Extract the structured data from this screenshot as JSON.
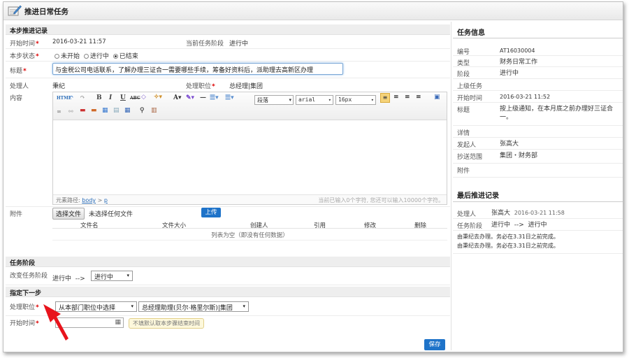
{
  "window": {
    "title": "推进日常任务"
  },
  "left": {
    "section_current": "本步推进记录",
    "start_time": {
      "label": "开始时间",
      "value": "2016-03-21 11:57"
    },
    "current_stage": {
      "label": "当前任务阶段",
      "value": "进行中"
    },
    "step_status": {
      "label": "本步状态",
      "options": [
        "未开始",
        "进行中",
        "已结束"
      ],
      "selected": "已结束"
    },
    "title": {
      "label": "标题",
      "value": "与金税公司电话联系，了解办理三证合一需要哪些手续，筹备好资料后，派助理去高新区办理"
    },
    "handler": {
      "label": "处理人",
      "value": "秉纪"
    },
    "handler_post": {
      "label": "处理职位",
      "value": "总经理|集团"
    },
    "content": {
      "label": "内容",
      "toolbar": {
        "html": "HTML",
        "bold": "B",
        "italic": "I",
        "underline": "U",
        "strike": "ABC",
        "font_color": "A",
        "paragraph": "段落",
        "font_family": "arial",
        "font_size": "16px"
      },
      "path_label": "元素路径:",
      "path_body": "body",
      "path_sep": ">",
      "path_p": "p",
      "counter": "当前已输入0个字符, 您还可以输入10000个字符。"
    },
    "attachment": {
      "label": "附件",
      "choose_btn": "选择文件",
      "no_file": "未选择任何文件",
      "upload_btn": "上传",
      "columns": [
        "文件名",
        "文件大小",
        "创建人",
        "引用",
        "修改",
        "删除"
      ],
      "empty": "列表为空（即没有任何数据）"
    },
    "section_stage": "任务阶段",
    "change_stage": {
      "label": "改变任务阶段",
      "from": "进行中",
      "arrow": "-->",
      "to": "进行中"
    },
    "section_next": "指定下一步",
    "next_post": {
      "label": "处理职位",
      "source": "从本部门职位中选择",
      "post": "总经理助理(贝尔·格里尔斯)|集团"
    },
    "next_start": {
      "label": "开始时间",
      "hint": "不填默认取本步骤结束时间"
    },
    "save_btn": "保存"
  },
  "right": {
    "task_info_title": "任务信息",
    "info": [
      {
        "key": "编号",
        "value": "AT16030004"
      },
      {
        "key": "类型",
        "value": "财务日常工作"
      },
      {
        "key": "阶段",
        "value": "进行中"
      },
      {
        "key": "上级任务",
        "value": ""
      },
      {
        "key": "开始时间",
        "value": "2016-03-21 11:52"
      },
      {
        "key": "标题",
        "value": "按上级通知，在本月底之前办理好三证合一。"
      },
      {
        "key": "详情",
        "value": ""
      },
      {
        "key": "发起人",
        "value": "张高大"
      },
      {
        "key": "抄送范围",
        "value": "集团・财务部"
      },
      {
        "key": "附件",
        "value": ""
      }
    ],
    "last_record_title": "最后推进记录",
    "last_record": {
      "handler_label": "处理人",
      "handler": "张高大",
      "time": "2016-03-21 11:58",
      "stage_label": "任务阶段",
      "stage_from": "进行中",
      "arrow": "-->",
      "stage_to": "进行中",
      "line1": "由秉纪去办理。务必在3.31日之前完成。",
      "line2": "由秉纪去办理。务必在3.31日之前完成。"
    }
  },
  "colors": {
    "accent": "#1e73c9",
    "required": "#dd0000",
    "arrow": "#e8141c"
  }
}
